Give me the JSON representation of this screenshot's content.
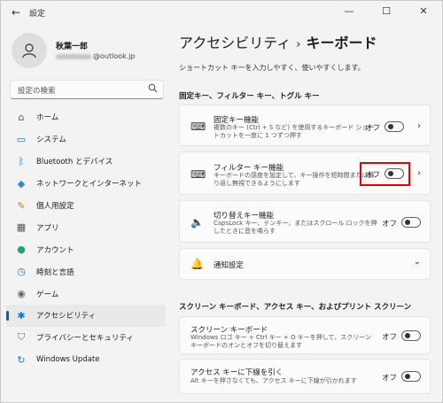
{
  "titlebar": {
    "back_icon": "←",
    "title": "設定",
    "minimize": "—",
    "maximize": "☐",
    "close": "✕"
  },
  "profile": {
    "name": "秋葉一郎",
    "email_suffix": "@outlook.jp"
  },
  "search": {
    "placeholder": "設定の検索",
    "icon": "search-icon"
  },
  "nav": [
    {
      "label": "ホーム",
      "icon": "⌂"
    },
    {
      "label": "システム",
      "icon": "▭"
    },
    {
      "label": "Bluetooth とデバイス",
      "icon": "ᛒ"
    },
    {
      "label": "ネットワークとインターネット",
      "icon": "◆"
    },
    {
      "label": "個人用設定",
      "icon": "✎"
    },
    {
      "label": "アプリ",
      "icon": "▦"
    },
    {
      "label": "アカウント",
      "icon": "●"
    },
    {
      "label": "時刻と言語",
      "icon": "◷"
    },
    {
      "label": "ゲーム",
      "icon": "◉"
    },
    {
      "label": "アクセシビリティ",
      "icon": "✱"
    },
    {
      "label": "プライバシーとセキュリティ",
      "icon": "⛉"
    },
    {
      "label": "Windows Update",
      "icon": "↻"
    }
  ],
  "breadcrumb": {
    "parent": "アクセシビリティ",
    "separator": "›",
    "current": "キーボード"
  },
  "subtitle": "ショートカット キーを入力しやすく、使いやすくします。",
  "section1": "固定キー、フィルター キー、トグル キー",
  "cards1": [
    {
      "title": "固定キー機能",
      "desc": "複数のキー (Ctrl + S など) を使用するキーボード ショートカットを一度に 1 つずつ押す",
      "state": "オフ",
      "icon": "⌨"
    },
    {
      "title": "フィルター キー機能",
      "desc": "キーボードの感度を設定して、キー操作を短時間または繰り返し無視できるようにします",
      "state": "オフ",
      "icon": "⌨"
    },
    {
      "title": "切り替えキー機能",
      "desc": "CapsLock キー、テンキー、またはスクロール ロックを押したときに音を鳴らす",
      "state": "オフ",
      "icon": "🔈"
    }
  ],
  "notify": {
    "label": "通知設定",
    "icon": "🔔",
    "chevron": "⌄"
  },
  "section2": "スクリーン キーボード、アクセス キー、およびプリント スクリーン",
  "cards2": [
    {
      "title": "スクリーン キーボード",
      "desc": "Windows ロゴ キー + Ctrl キー + O キーを押して、スクリーン キーボードのオンとオフを切り替えます",
      "state": "オフ"
    },
    {
      "title": "アクセス キーに下線を引く",
      "desc": "Alt キーを押さなくても、アクセス キーに下線が引かれます",
      "state": "オフ"
    }
  ],
  "chevron": "›"
}
